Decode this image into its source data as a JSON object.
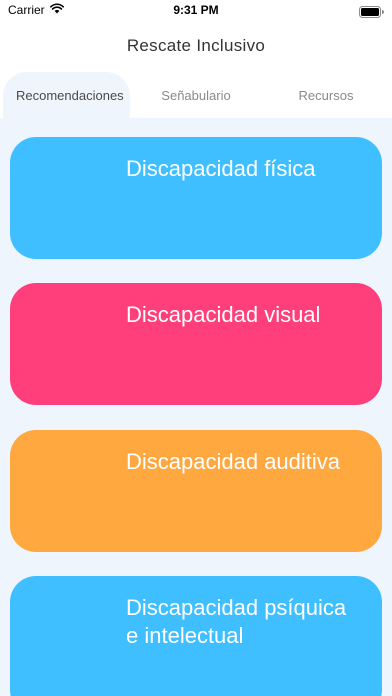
{
  "status_bar": {
    "carrier": "Carrier",
    "time": "9:31 PM",
    "icons": [
      "wifi-icon",
      "battery-icon"
    ]
  },
  "nav": {
    "title": "Rescate Inclusivo"
  },
  "tabs": [
    {
      "label": "Recomendaciones",
      "active": true
    },
    {
      "label": "Señabulario",
      "active": false
    },
    {
      "label": "Recursos",
      "active": false
    }
  ],
  "cards": [
    {
      "title": "Discapacidad física",
      "color": "#3fbfff"
    },
    {
      "title": "Discapacidad visual",
      "color": "#ff3e7c"
    },
    {
      "title": "Discapacidad auditiva",
      "color": "#ffa840"
    },
    {
      "title": "Discapacidad psíquica e intelectual",
      "color": "#3fbfff"
    }
  ],
  "colors": {
    "content_background": "#eef5fd",
    "text_secondary": "#8a8a8a"
  }
}
